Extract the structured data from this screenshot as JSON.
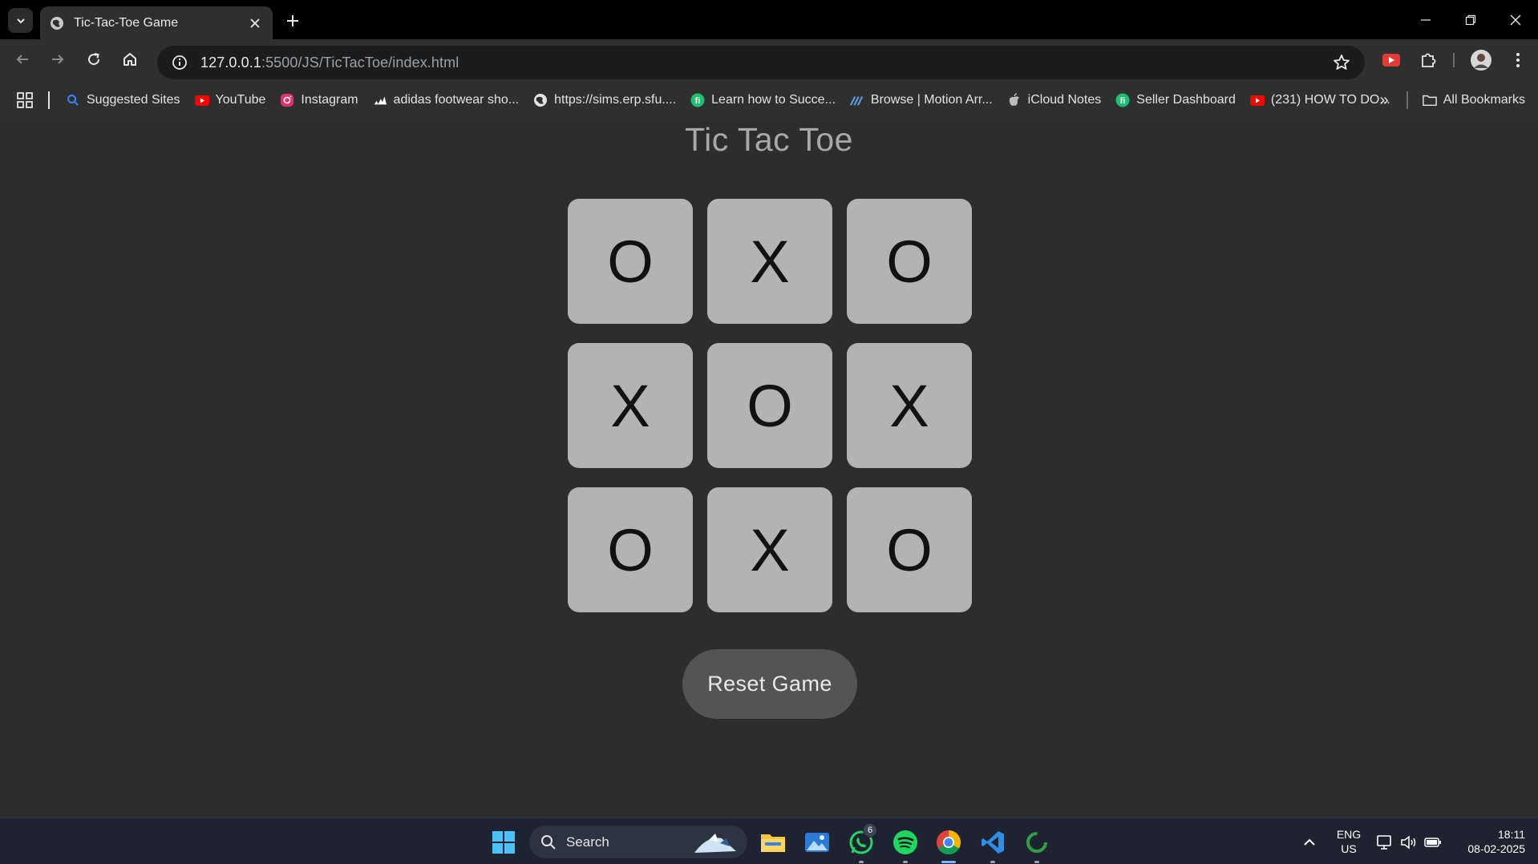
{
  "browser": {
    "tab": {
      "title": "Tic-Tac-Toe Game"
    },
    "url": {
      "host": "127.0.0.1",
      "path": ":5500/JS/TicTacToe/index.html"
    },
    "bookmarks": [
      {
        "label": "Suggested Sites",
        "icon": "search-icon",
        "color": "#3b82f6"
      },
      {
        "label": "YouTube",
        "icon": "youtube-icon",
        "color": "#ff0000"
      },
      {
        "label": "Instagram",
        "icon": "instagram-icon",
        "color": "#e1306c"
      },
      {
        "label": "adidas footwear sho...",
        "icon": "adidas-icon",
        "color": "#ffffff"
      },
      {
        "label": "https://sims.erp.sfu....",
        "icon": "globe-icon",
        "color": "#e3e3e3"
      },
      {
        "label": "Learn how to Succe...",
        "icon": "fiverr-icon",
        "color": "#1dbf73"
      },
      {
        "label": "Browse | Motion Arr...",
        "icon": "motion-array-icon",
        "color": "#5b9bd5"
      },
      {
        "label": "iCloud Notes",
        "icon": "apple-icon",
        "color": "#bdbdbd"
      },
      {
        "label": "Seller Dashboard",
        "icon": "fiverr-icon",
        "color": "#1dbf73"
      },
      {
        "label": "(231) HOW TO DO...",
        "icon": "youtube-icon",
        "color": "#ff0000"
      }
    ],
    "all_bookmarks_label": "All Bookmarks"
  },
  "game": {
    "title": "Tic Tac Toe",
    "board": [
      "O",
      "X",
      "O",
      "X",
      "O",
      "X",
      "O",
      "X",
      "O"
    ],
    "reset_label": "Reset Game"
  },
  "taskbar": {
    "search_label": "Search",
    "whatsapp_badge": "6",
    "language": {
      "line1": "ENG",
      "line2": "US"
    },
    "clock": {
      "time": "18:11",
      "date": "08-02-2025"
    }
  }
}
